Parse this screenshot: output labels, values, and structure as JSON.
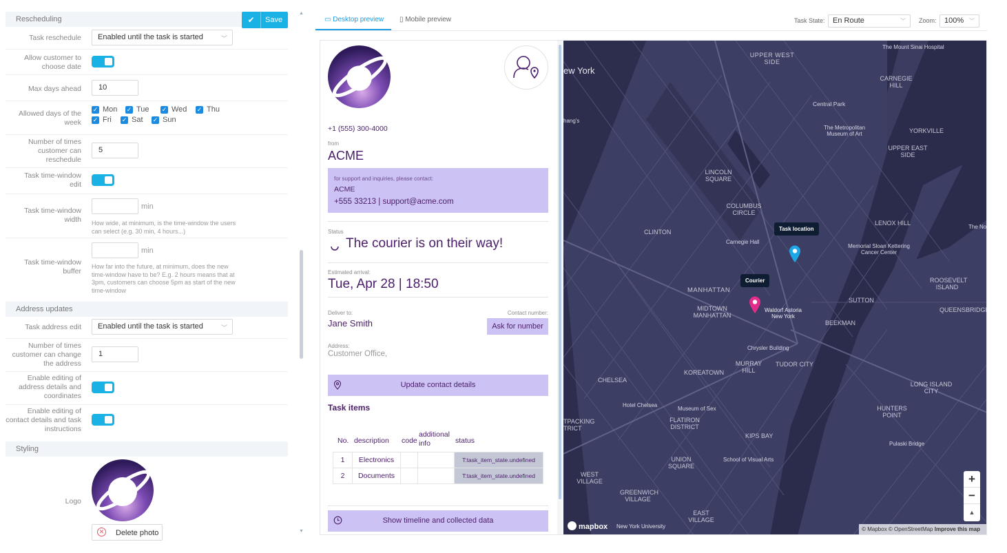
{
  "settings": {
    "rescheduling": {
      "title": "Rescheduling",
      "save_label": "Save",
      "task_reschedule_label": "Task reschedule",
      "task_reschedule_value": "Enabled until the task is started",
      "allow_customer_choose_label": "Allow customer to choose date",
      "max_days_label": "Max days ahead",
      "max_days_value": "10",
      "allowed_days_label": "Allowed days of the week",
      "days": [
        "Mon",
        "Tue",
        "Wed",
        "Thu",
        "Fri",
        "Sat",
        "Sun"
      ],
      "reschedule_times_label": "Number of times customer can reschedule",
      "reschedule_times_value": "5",
      "time_window_edit_label": "Task time-window edit",
      "time_window_width_label": "Task time-window width",
      "time_window_width_unit": "min",
      "time_window_width_hint": "How wide, at minimum, is the time-window the users can select (e.g. 30 min, 4 hours...)",
      "time_window_buffer_label": "Task time-window buffer",
      "time_window_buffer_unit": "min",
      "time_window_buffer_hint": "How far into the future, at minimum, does the new time-window have to be? E.g. 2 hours means that at 3pm, customers can choose 5pm as start of the new time-window"
    },
    "address": {
      "title": "Address updates",
      "task_address_edit_label": "Task address edit",
      "task_address_edit_value": "Enabled until the task is started",
      "change_times_label": "Number of times customer can change the address",
      "change_times_value": "1",
      "edit_address_label": "Enable editing of address details and coordinates",
      "edit_contact_label": "Enable editing of contact details and task instructions"
    },
    "styling": {
      "title": "Styling",
      "logo_label": "Logo",
      "delete_photo_label": "Delete photo"
    }
  },
  "preview": {
    "tabs": [
      "Desktop preview",
      "Mobile preview"
    ],
    "task_state_label": "Task State:",
    "task_state_value": "En Route",
    "zoom_label": "Zoom:",
    "zoom_value": "100%"
  },
  "card": {
    "phone": "+1 (555) 300-4000",
    "from_label": "from",
    "company": "ACME",
    "support_intro": "for support and inquiries, please contact:",
    "support_company": "ACME",
    "support_contact": "+555 33213 | support@acme.com",
    "status_label": "Status",
    "status_text": "The courier is on their way!",
    "eta_label": "Estimated arrival:",
    "eta_value": "Tue, Apr 28 | 18:50",
    "deliver_to_label": "Deliver to:",
    "deliver_to_name": "Jane Smith",
    "contact_number_label": "Contact number:",
    "ask_number_label": "Ask for number",
    "address_label": "Address:",
    "address_value": "Customer Office,",
    "update_contact_label": "Update contact details",
    "task_items_title": "Task items",
    "items_headers": [
      "No.",
      "description",
      "code",
      "additional info",
      "status"
    ],
    "items": [
      {
        "no": "1",
        "description": "Electronics",
        "code": "",
        "info": "",
        "status": "T:task_item_state.undefined"
      },
      {
        "no": "2",
        "description": "Documents",
        "code": "",
        "info": "",
        "status": "T:task_item_state.undefined"
      }
    ],
    "timeline_label": "Show timeline and collected data"
  },
  "map": {
    "task_location_label": "Task location",
    "courier_label": "Courier",
    "attribution": "© Mapbox © OpenStreetMap",
    "improve_label": "Improve this map",
    "logo_label": "mapbox",
    "zoom_in": "+",
    "zoom_out": "−",
    "compass": "▲",
    "labels": {
      "new_york": "ew York",
      "upper_west": "UPPER WEST SIDE",
      "mount_sinai": "The Mount Sinai Hospital",
      "carnegie_hill": "CARNEGIE HILL",
      "central_park": "Central Park",
      "yorkville": "YORKVILLE",
      "met_museum": "The Metropolitan Museum of Art",
      "upper_east": "UPPER EAST SIDE",
      "lincoln_square": "LINCOLN SQUARE",
      "columbus_circle": "COLUMBUS CIRCLE",
      "lenox_hill": "LENOX HILL",
      "clinton": "CLINTON",
      "carnegie_hall": "Carnegie Hall",
      "memorial": "Memorial Sloan Kettering Cancer Center",
      "roosevelt": "ROOSEVELT ISLAND",
      "manhattan": "MANHATTAN",
      "midtown": "MIDTOWN MANHATTAN",
      "waldorf": "Waldorf Astoria New York",
      "sutton": "SUTTON",
      "queensbridge": "QUEENSBRIDGE",
      "beekman": "BEEKMAN",
      "chrysler": "Chrysler Building",
      "murray_hill": "MURRAY HILL",
      "tudor_city": "TUDOR CITY",
      "koreatown": "KOREATOWN",
      "chelsea": "CHELSEA",
      "long_island": "LONG ISLAND CITY",
      "hotel_chelsea": "Hotel Chelsea",
      "museum_sex": "Museum of Sex",
      "flatiron": "FLATIRON DISTRICT",
      "hunters_point": "HUNTERS POINT",
      "meatpacking": "TPACKING TRICT",
      "kips_bay": "KIPS BAY",
      "union_square": "UNION SQUARE",
      "school_visual": "School of Visual Arts",
      "pulaski": "Pulaski Bridge",
      "west_village": "WEST VILLAGE",
      "greenwich": "GREENWICH VILLAGE",
      "east_village": "EAST VILLAGE",
      "nyu": "New York University",
      "hangs": "hang's",
      "the_no": "The No"
    }
  }
}
